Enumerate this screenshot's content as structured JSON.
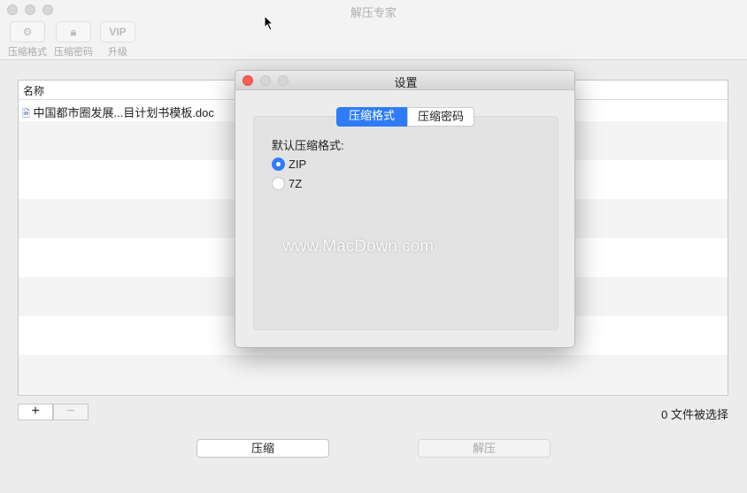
{
  "window": {
    "title": "解压专家"
  },
  "toolbar": [
    {
      "label": "压缩格式",
      "icon": "gear-icon"
    },
    {
      "label": "压缩密码",
      "icon": "lock-icon"
    },
    {
      "label": "升级",
      "icon_text": "VIP"
    }
  ],
  "table": {
    "column": "名称",
    "files": [
      "中国都市圈发展...目计划书模板.doc"
    ]
  },
  "status": "0 文件被选择",
  "add_label": "+",
  "remove_label": "−",
  "buttons": {
    "compress": "压缩",
    "decompress": "解压"
  },
  "dialog": {
    "title": "设置",
    "tabs": [
      "压缩格式",
      "压缩密码"
    ],
    "section_label": "默认压缩格式:",
    "options": [
      {
        "label": "ZIP",
        "selected": true
      },
      {
        "label": "7Z",
        "selected": false
      }
    ]
  },
  "watermark": "www.MacDown.com",
  "colors": {
    "accent": "#2f7cf6",
    "close": "#fc605b"
  }
}
